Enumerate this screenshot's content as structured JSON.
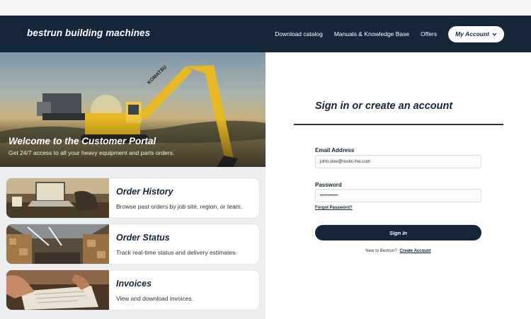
{
  "header": {
    "brand": "bestrun building machines",
    "nav": [
      "Download catalog",
      "Manuals & Knowledge Base",
      "Offers"
    ],
    "account_label": "My Account"
  },
  "hero": {
    "title": "Welcome to the Customer Portal",
    "subtitle": "Get 24/7 access to all your heavy equipment and parts orders.",
    "machine_brand": "KOMATSU"
  },
  "cards": [
    {
      "title": "Order History",
      "description": "Browse past orders by job site, region, or team."
    },
    {
      "title": "Order Status",
      "description": "Track real-time status and delivery estimates."
    },
    {
      "title": "Invoices",
      "description": "View and download invoices."
    }
  ],
  "signin": {
    "title": "Sign in or create an account",
    "email_label": "Email Address",
    "email_value": "john.doe@rustic-hw.com",
    "password_label": "Password",
    "password_value": "•••••••••••",
    "forgot_label": "Forgot Password?",
    "button_label": "Sign In",
    "new_prompt": "New to Bestrun?",
    "create_label": "Create Account"
  },
  "colors": {
    "navy": "#15253a",
    "excavator_yellow": "#e8b923"
  }
}
